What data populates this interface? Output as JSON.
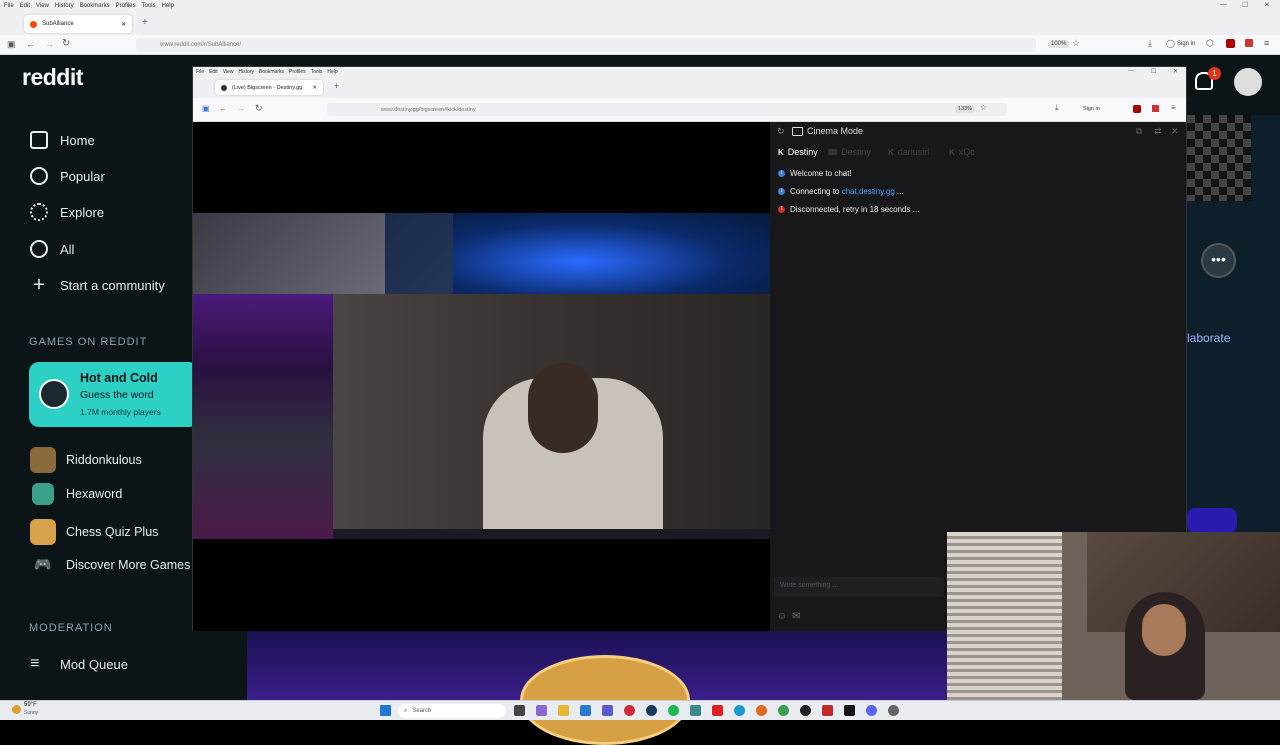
{
  "outer_browser": {
    "menu": [
      "File",
      "Edit",
      "View",
      "History",
      "Bookmarks",
      "Profiles",
      "Tools",
      "Help"
    ],
    "tab_title": "SubAlliance",
    "url": "www.reddit.com/r/SubAlliance/",
    "zoom": "100%",
    "sign_in": "Sign in"
  },
  "reddit": {
    "logo": "reddit",
    "notification_count": "1",
    "nav": [
      {
        "label": "Home",
        "icon": "home-icon"
      },
      {
        "label": "Popular",
        "icon": "popular-icon"
      },
      {
        "label": "Explore",
        "icon": "explore-icon"
      },
      {
        "label": "All",
        "icon": "all-icon"
      },
      {
        "label": "Start a community",
        "icon": "plus-icon"
      }
    ],
    "games_section": "GAMES ON REDDIT",
    "featured_game": {
      "title": "Hot and Cold",
      "subtitle": "Guess the word",
      "players": "1.7M monthly players"
    },
    "games": [
      "Riddonkulous",
      "Hexaword",
      "Chess Quiz Plus",
      "Discover More Games"
    ],
    "moderation_section": "MODERATION",
    "mod_queue": "Mod Queue",
    "right_text": "laborate"
  },
  "inner_browser": {
    "menu": [
      "File",
      "Edit",
      "View",
      "History",
      "Bookmarks",
      "Profiles",
      "Tools",
      "Help"
    ],
    "tab_title": "(Live) Bigscreen - Destiny.gg",
    "url": "www.destiny.gg/bigscreen#kick/destiny",
    "zoom": "133%",
    "sign_in": "Sign in"
  },
  "chat": {
    "mode": "Cinema Mode",
    "tabs": [
      "Destiny",
      "Destiny",
      "dariusirl",
      "xQc"
    ],
    "messages": [
      {
        "text": "Welcome to chat!",
        "link": "",
        "after": "",
        "color": "#4a7fd0"
      },
      {
        "text": "Connecting to ",
        "link": "chat.destiny.gg",
        "after": " ...",
        "color": "#4a7fd0"
      },
      {
        "text": "Disconnected, retry in 18 seconds ...",
        "link": "",
        "after": "",
        "color": "#d03030"
      }
    ],
    "input_placeholder": "Write something ..."
  },
  "taskbar": {
    "weather_temp": "59°F",
    "weather_desc": "Sunny",
    "search_label": "Search"
  }
}
